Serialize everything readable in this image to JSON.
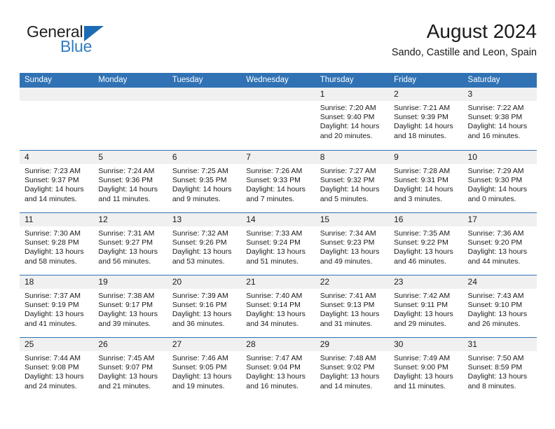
{
  "brand": {
    "name_top": "General",
    "name_bottom": "Blue",
    "triangle_icon": "triangle-icon",
    "accent_color": "#1c6cb5",
    "text_color": "#231f20"
  },
  "header": {
    "title": "August 2024",
    "subtitle": "Sando, Castille and Leon, Spain"
  },
  "calendar": {
    "header_bg": "#3072b4",
    "header_text_color": "#ffffff",
    "date_band_bg": "#f0f0f0",
    "weekdays": [
      "Sunday",
      "Monday",
      "Tuesday",
      "Wednesday",
      "Thursday",
      "Friday",
      "Saturday"
    ],
    "weeks": [
      [
        {
          "day": "",
          "empty": true
        },
        {
          "day": "",
          "empty": true
        },
        {
          "day": "",
          "empty": true
        },
        {
          "day": "",
          "empty": true
        },
        {
          "day": "1",
          "sunrise": "Sunrise: 7:20 AM",
          "sunset": "Sunset: 9:40 PM",
          "daylight": "Daylight: 14 hours and 20 minutes."
        },
        {
          "day": "2",
          "sunrise": "Sunrise: 7:21 AM",
          "sunset": "Sunset: 9:39 PM",
          "daylight": "Daylight: 14 hours and 18 minutes."
        },
        {
          "day": "3",
          "sunrise": "Sunrise: 7:22 AM",
          "sunset": "Sunset: 9:38 PM",
          "daylight": "Daylight: 14 hours and 16 minutes."
        }
      ],
      [
        {
          "day": "4",
          "sunrise": "Sunrise: 7:23 AM",
          "sunset": "Sunset: 9:37 PM",
          "daylight": "Daylight: 14 hours and 14 minutes."
        },
        {
          "day": "5",
          "sunrise": "Sunrise: 7:24 AM",
          "sunset": "Sunset: 9:36 PM",
          "daylight": "Daylight: 14 hours and 11 minutes."
        },
        {
          "day": "6",
          "sunrise": "Sunrise: 7:25 AM",
          "sunset": "Sunset: 9:35 PM",
          "daylight": "Daylight: 14 hours and 9 minutes."
        },
        {
          "day": "7",
          "sunrise": "Sunrise: 7:26 AM",
          "sunset": "Sunset: 9:33 PM",
          "daylight": "Daylight: 14 hours and 7 minutes."
        },
        {
          "day": "8",
          "sunrise": "Sunrise: 7:27 AM",
          "sunset": "Sunset: 9:32 PM",
          "daylight": "Daylight: 14 hours and 5 minutes."
        },
        {
          "day": "9",
          "sunrise": "Sunrise: 7:28 AM",
          "sunset": "Sunset: 9:31 PM",
          "daylight": "Daylight: 14 hours and 3 minutes."
        },
        {
          "day": "10",
          "sunrise": "Sunrise: 7:29 AM",
          "sunset": "Sunset: 9:30 PM",
          "daylight": "Daylight: 14 hours and 0 minutes."
        }
      ],
      [
        {
          "day": "11",
          "sunrise": "Sunrise: 7:30 AM",
          "sunset": "Sunset: 9:28 PM",
          "daylight": "Daylight: 13 hours and 58 minutes."
        },
        {
          "day": "12",
          "sunrise": "Sunrise: 7:31 AM",
          "sunset": "Sunset: 9:27 PM",
          "daylight": "Daylight: 13 hours and 56 minutes."
        },
        {
          "day": "13",
          "sunrise": "Sunrise: 7:32 AM",
          "sunset": "Sunset: 9:26 PM",
          "daylight": "Daylight: 13 hours and 53 minutes."
        },
        {
          "day": "14",
          "sunrise": "Sunrise: 7:33 AM",
          "sunset": "Sunset: 9:24 PM",
          "daylight": "Daylight: 13 hours and 51 minutes."
        },
        {
          "day": "15",
          "sunrise": "Sunrise: 7:34 AM",
          "sunset": "Sunset: 9:23 PM",
          "daylight": "Daylight: 13 hours and 49 minutes."
        },
        {
          "day": "16",
          "sunrise": "Sunrise: 7:35 AM",
          "sunset": "Sunset: 9:22 PM",
          "daylight": "Daylight: 13 hours and 46 minutes."
        },
        {
          "day": "17",
          "sunrise": "Sunrise: 7:36 AM",
          "sunset": "Sunset: 9:20 PM",
          "daylight": "Daylight: 13 hours and 44 minutes."
        }
      ],
      [
        {
          "day": "18",
          "sunrise": "Sunrise: 7:37 AM",
          "sunset": "Sunset: 9:19 PM",
          "daylight": "Daylight: 13 hours and 41 minutes."
        },
        {
          "day": "19",
          "sunrise": "Sunrise: 7:38 AM",
          "sunset": "Sunset: 9:17 PM",
          "daylight": "Daylight: 13 hours and 39 minutes."
        },
        {
          "day": "20",
          "sunrise": "Sunrise: 7:39 AM",
          "sunset": "Sunset: 9:16 PM",
          "daylight": "Daylight: 13 hours and 36 minutes."
        },
        {
          "day": "21",
          "sunrise": "Sunrise: 7:40 AM",
          "sunset": "Sunset: 9:14 PM",
          "daylight": "Daylight: 13 hours and 34 minutes."
        },
        {
          "day": "22",
          "sunrise": "Sunrise: 7:41 AM",
          "sunset": "Sunset: 9:13 PM",
          "daylight": "Daylight: 13 hours and 31 minutes."
        },
        {
          "day": "23",
          "sunrise": "Sunrise: 7:42 AM",
          "sunset": "Sunset: 9:11 PM",
          "daylight": "Daylight: 13 hours and 29 minutes."
        },
        {
          "day": "24",
          "sunrise": "Sunrise: 7:43 AM",
          "sunset": "Sunset: 9:10 PM",
          "daylight": "Daylight: 13 hours and 26 minutes."
        }
      ],
      [
        {
          "day": "25",
          "sunrise": "Sunrise: 7:44 AM",
          "sunset": "Sunset: 9:08 PM",
          "daylight": "Daylight: 13 hours and 24 minutes."
        },
        {
          "day": "26",
          "sunrise": "Sunrise: 7:45 AM",
          "sunset": "Sunset: 9:07 PM",
          "daylight": "Daylight: 13 hours and 21 minutes."
        },
        {
          "day": "27",
          "sunrise": "Sunrise: 7:46 AM",
          "sunset": "Sunset: 9:05 PM",
          "daylight": "Daylight: 13 hours and 19 minutes."
        },
        {
          "day": "28",
          "sunrise": "Sunrise: 7:47 AM",
          "sunset": "Sunset: 9:04 PM",
          "daylight": "Daylight: 13 hours and 16 minutes."
        },
        {
          "day": "29",
          "sunrise": "Sunrise: 7:48 AM",
          "sunset": "Sunset: 9:02 PM",
          "daylight": "Daylight: 13 hours and 14 minutes."
        },
        {
          "day": "30",
          "sunrise": "Sunrise: 7:49 AM",
          "sunset": "Sunset: 9:00 PM",
          "daylight": "Daylight: 13 hours and 11 minutes."
        },
        {
          "day": "31",
          "sunrise": "Sunrise: 7:50 AM",
          "sunset": "Sunset: 8:59 PM",
          "daylight": "Daylight: 13 hours and 8 minutes."
        }
      ]
    ]
  }
}
